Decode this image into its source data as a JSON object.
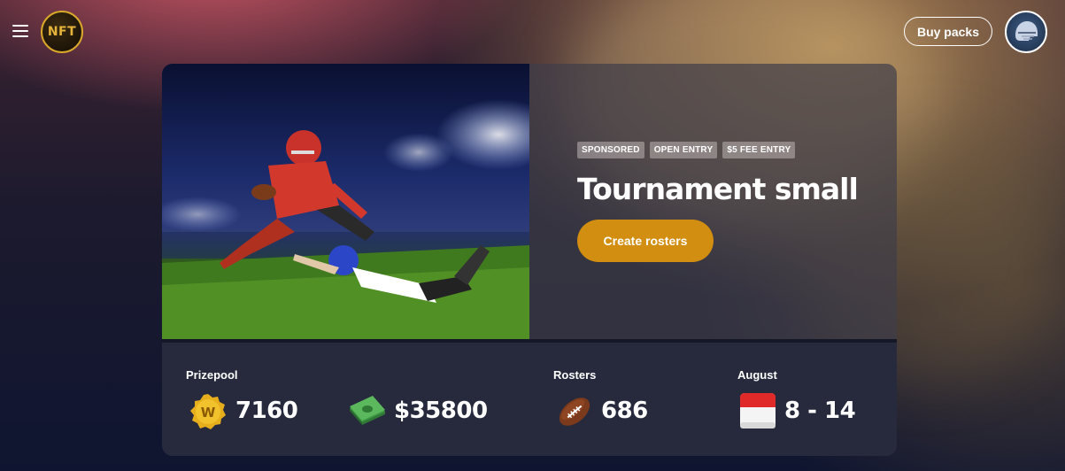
{
  "header": {
    "logo_text": "NFT",
    "buy_packs_label": "Buy packs"
  },
  "tournament": {
    "tags": [
      "SPONSORED",
      "OPEN ENTRY",
      "$5 FEE ENTRY"
    ],
    "title": "Tournament small",
    "cta_label": "Create rosters"
  },
  "stats": {
    "prizepool_label": "Prizepool",
    "coins_value": "7160",
    "cash_value": "$35800",
    "rosters_label": "Rosters",
    "rosters_value": "686",
    "month_label": "August",
    "date_range": "8 - 14"
  },
  "icons": {
    "menu": "hamburger-menu-icon",
    "coin": "coin-w-icon",
    "cash": "cash-stack-icon",
    "football": "football-icon",
    "calendar": "calendar-icon",
    "avatar": "helmet-avatar-icon"
  },
  "colors": {
    "accent": "#d28e10",
    "coin": "#f2c22c",
    "cash": "#5bb85c",
    "calendar_red": "#e02a2a"
  }
}
